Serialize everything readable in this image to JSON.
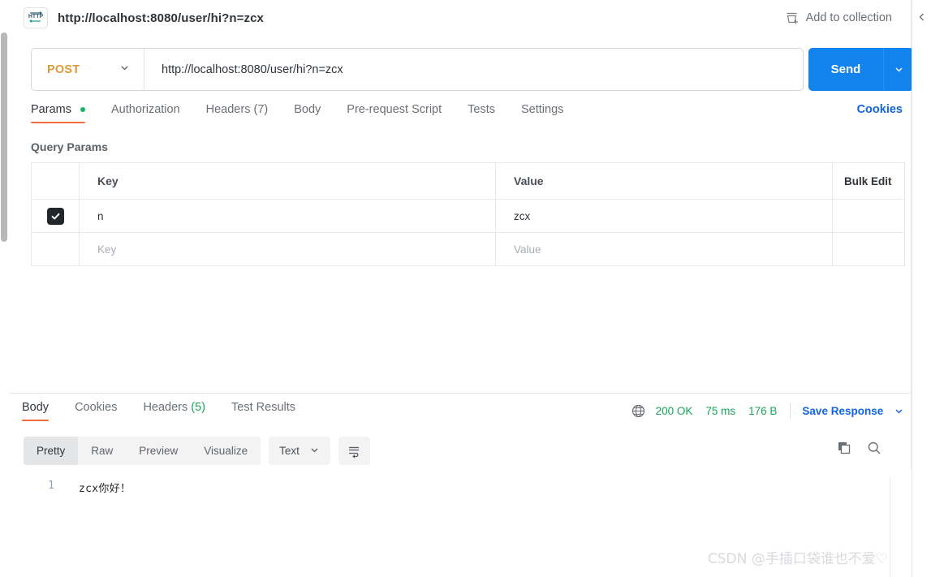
{
  "header": {
    "icon": "http-protocol-icon",
    "title": "http://localhost:8080/user/hi?n=zcx",
    "add_to_collection": "Add to collection",
    "collapse_icon": "chevron-left-icon"
  },
  "request": {
    "method": "POST",
    "method_caret_icon": "chevron-down-icon",
    "url": "http://localhost:8080/user/hi?n=zcx",
    "send_label": "Send",
    "send_caret_icon": "chevron-down-icon",
    "send_color": "#1384ed",
    "method_color": "#d99b33"
  },
  "request_tabs": {
    "items": [
      {
        "label": "Params",
        "active": true,
        "dot": true
      },
      {
        "label": "Authorization",
        "active": false
      },
      {
        "label": "Headers",
        "count": "(7)",
        "active": false
      },
      {
        "label": "Body",
        "active": false
      },
      {
        "label": "Pre-request Script",
        "active": false
      },
      {
        "label": "Tests",
        "active": false
      },
      {
        "label": "Settings",
        "active": false
      }
    ],
    "cookies_link": "Cookies",
    "active_underline_color": "#f26b3a",
    "dot_color": "#18b566"
  },
  "query_params": {
    "section_title": "Query Params",
    "columns": [
      "Key",
      "Value",
      "Bulk Edit"
    ],
    "rows": [
      {
        "checked": true,
        "key": "n",
        "value": "zcx"
      }
    ],
    "empty_row": {
      "key_placeholder": "Key",
      "value_placeholder": "Value"
    }
  },
  "response_tabs": {
    "items": [
      {
        "label": "Body",
        "active": true
      },
      {
        "label": "Cookies",
        "active": false
      },
      {
        "label": "Headers",
        "count": "(5)",
        "active": false
      },
      {
        "label": "Test Results",
        "active": false
      }
    ]
  },
  "response_meta": {
    "globe_icon": "globe-icon",
    "status": "200 OK",
    "time": "75 ms",
    "size": "176 B",
    "save_response": "Save Response",
    "save_caret_icon": "chevron-down-icon",
    "status_color": "#18a558"
  },
  "format_toolbar": {
    "segments": [
      {
        "label": "Pretty",
        "active": true
      },
      {
        "label": "Raw",
        "active": false
      },
      {
        "label": "Preview",
        "active": false
      },
      {
        "label": "Visualize",
        "active": false
      }
    ],
    "type": "Text",
    "type_caret_icon": "chevron-down-icon",
    "wrap_icon": "word-wrap-icon",
    "copy_icon": "copy-icon",
    "search_icon": "search-icon"
  },
  "response_body": {
    "lines": [
      {
        "number": "1",
        "text": "zcx你好！"
      }
    ]
  },
  "watermark": "CSDN @手插口袋谁也不爱♡"
}
